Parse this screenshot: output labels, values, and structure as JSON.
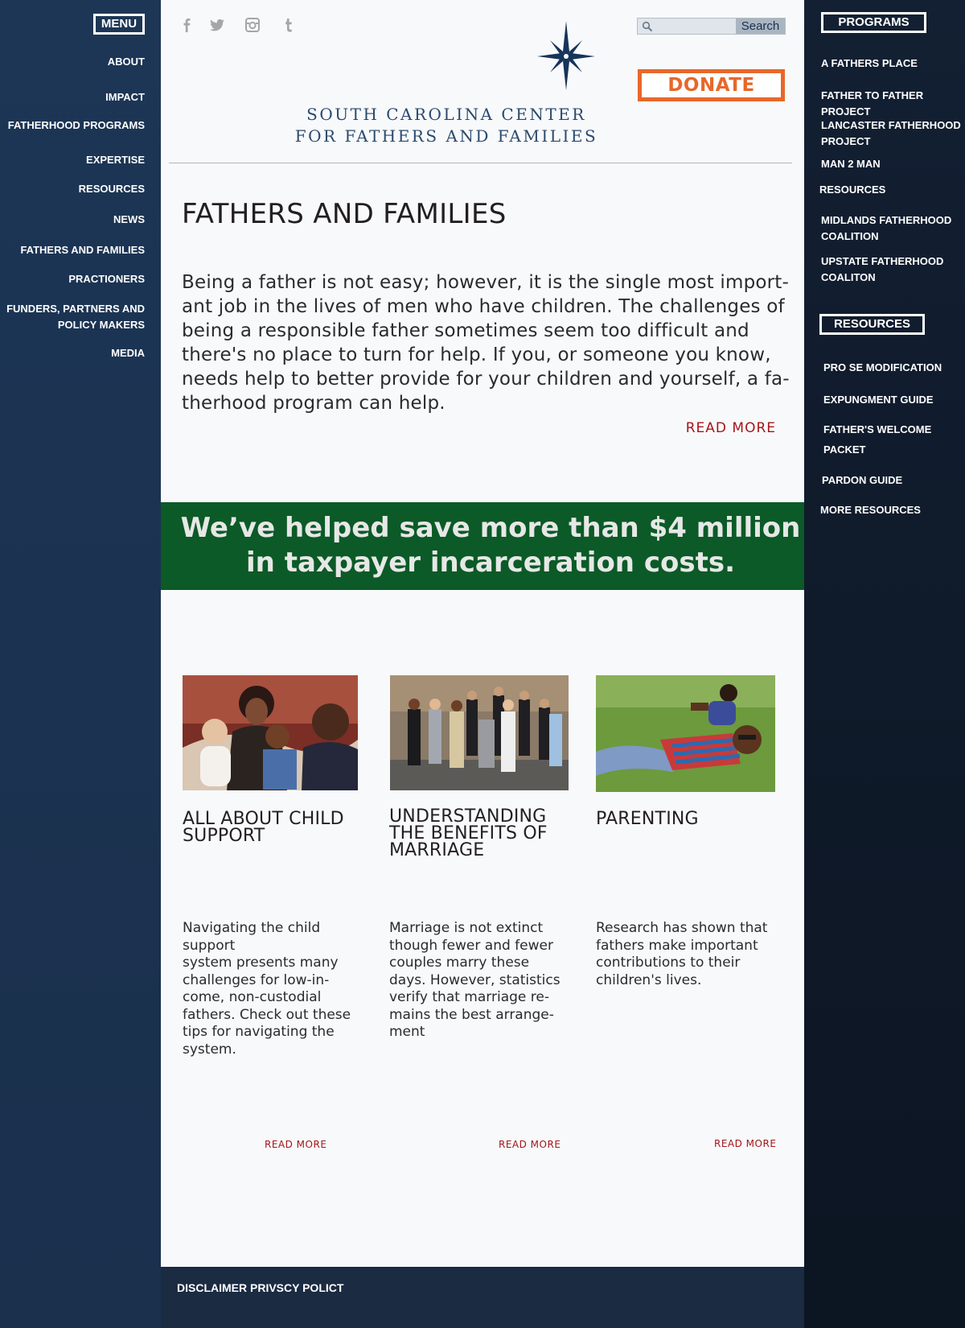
{
  "left_menu": {
    "badge": "MENU",
    "items": [
      {
        "label": "ABOUT"
      },
      {
        "label": "IMPACT"
      },
      {
        "label": "FATHERHOOD PROGRAMS"
      },
      {
        "label": "EXPERTISE"
      },
      {
        "label": "RESOURCES"
      },
      {
        "label": "NEWS"
      },
      {
        "label": "FATHERS AND FAMILIES"
      },
      {
        "label": "PRACTIONERS"
      },
      {
        "label": "FUNDERS, PARTNERS AND"
      },
      {
        "label": "POLICY MAKERS"
      },
      {
        "label": "MEDIA"
      }
    ]
  },
  "header": {
    "social_icons": [
      "facebook-icon",
      "twitter-icon",
      "instagram-icon",
      "tumblr-icon"
    ],
    "search": {
      "placeholder": "",
      "button": "Search"
    },
    "donate": "DONATE",
    "logo_line1": "SOUTH CAROLINA CENTER",
    "logo_line2": "FOR FATHERS AND FAMILIES"
  },
  "main": {
    "title": "FATHERS AND FAMILIES",
    "intro_lines": [
      "Being a father is not easy; however, it is the single most import-",
      "ant job in the lives of men who have children. The challenges of",
      "being a responsible father sometimes seem too difficult and",
      "there's no place to turn for help. If you, or someone you know,",
      "needs help to better provide for your children and yourself, a fa-",
      "therhood program can help."
    ],
    "read_more": "READ MORE",
    "banner_line1": "We’ve helped save more than $4 million",
    "banner_line2": "in taxpayer incarceration costs.",
    "cards": [
      {
        "title_lines": [
          "ALL ABOUT CHILD",
          "SUPPORT"
        ],
        "body_lines": [
          "Navigating the child",
          "support",
          "system presents many",
          "challenges for low-in-",
          "come, non-custodial",
          "fathers. Check out these",
          "tips for navigating the",
          "system."
        ],
        "read_more": "READ MORE"
      },
      {
        "title_lines": [
          "UNDERSTANDING",
          "THE BENEFITS OF",
          "MARRIAGE"
        ],
        "body_lines": [
          "Marriage is not extinct",
          "though fewer and fewer",
          "couples marry these",
          "days. However, statistics",
          "verify that marriage re-",
          "mains the best arrange-",
          "ment"
        ],
        "read_more": "READ MORE"
      },
      {
        "title_lines": [
          "PARENTING"
        ],
        "body_lines": [
          "Research has shown that",
          "fathers make important",
          "contributions to their",
          "children's lives."
        ],
        "read_more": "READ MORE"
      }
    ]
  },
  "right_sidebar": {
    "programs_badge": "PROGRAMS",
    "programs": [
      {
        "label": "A FATHERS PLACE"
      },
      {
        "label": "FATHER TO FATHER PROJECT"
      },
      {
        "label": "LANCASTER FATHERHOOD"
      },
      {
        "label": "PROJECT"
      },
      {
        "label": "MAN 2 MAN"
      },
      {
        "label": "RESOURCES"
      },
      {
        "label": "MIDLANDS FATHERHOOD"
      },
      {
        "label": "COALITION"
      },
      {
        "label": "UPSTATE FATHERHOOD"
      },
      {
        "label": "COALITON"
      }
    ],
    "resources_badge": "RESOURCES",
    "resources": [
      {
        "label": "PRO SE MODIFICATION"
      },
      {
        "label": "EXPUNGMENT GUIDE"
      },
      {
        "label": "FATHER'S WELCOME"
      },
      {
        "label": "PACKET"
      },
      {
        "label": "PARDON GUIDE"
      },
      {
        "label": "MORE RESOURCES"
      }
    ]
  },
  "footer": {
    "text": "DISCLAIMER PRIVSCY POLICT"
  },
  "colors": {
    "left_sidebar": "#1d3656",
    "right_sidebar": "#0f1a2a",
    "banner": "#0b5a27",
    "donate": "#e8672a",
    "link_red": "#a4161a",
    "logo_navy": "#2a4a6e"
  }
}
